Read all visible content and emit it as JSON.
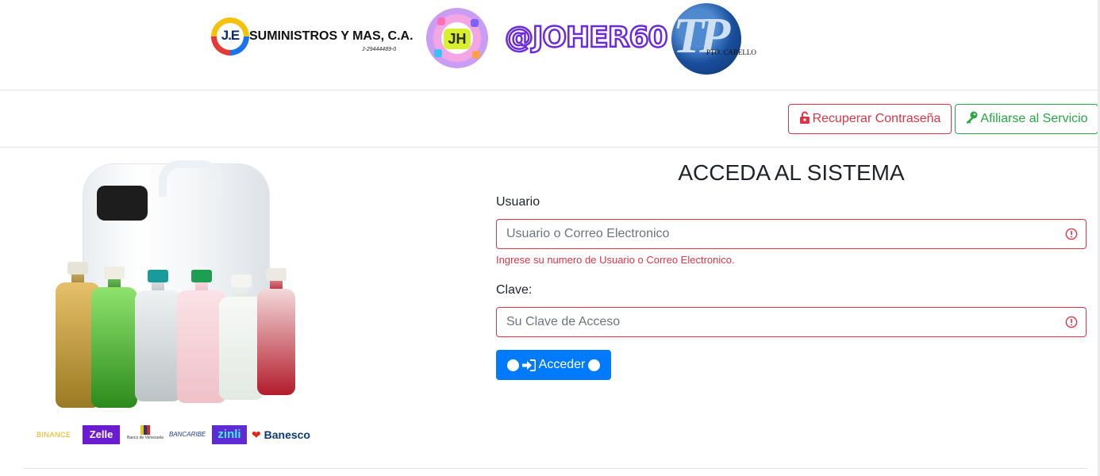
{
  "header": {
    "company_logo_initials": "J.E",
    "company_logo_name": "SUMINISTROS Y MAS, C.A.",
    "company_logo_rif": "J-29444489-0",
    "store_logo_initials": "JH",
    "social_handle": "@JOHER60",
    "location_logo_letters": "TP",
    "location_logo_caption": "PTO. CABELLO"
  },
  "actions": {
    "recover_password_label": "Recuperar Contraseña",
    "affiliate_label": "Afiliarse al Servicio",
    "recover_icon": "unlock-icon",
    "affiliate_icon": "key-icon",
    "recover_color": "#dc3545",
    "affiliate_color": "#28a745"
  },
  "product_image": {
    "description_icon": "product-bottles-image"
  },
  "payment_methods": {
    "binance": "BINANCE",
    "zelle": "Zelle",
    "bdv": "Banco de Venezuela",
    "bancaribe": "BANCARIBE",
    "zinli": "zinli",
    "banesco": "Banesco"
  },
  "login": {
    "title": "ACCEDA AL SISTEMA",
    "user_label": "Usuario",
    "user_placeholder": "Usuario o Correo Electronico",
    "user_value": "",
    "user_error": "Ingrese su numero de Usuario o Correo Electronico.",
    "password_label": "Clave:",
    "password_placeholder": "Su Clave de Acceso",
    "password_value": "",
    "submit_label": "Acceder",
    "submit_icon": "sign-in-icon",
    "submit_color": "#007bff",
    "error_color": "#dc3545"
  }
}
